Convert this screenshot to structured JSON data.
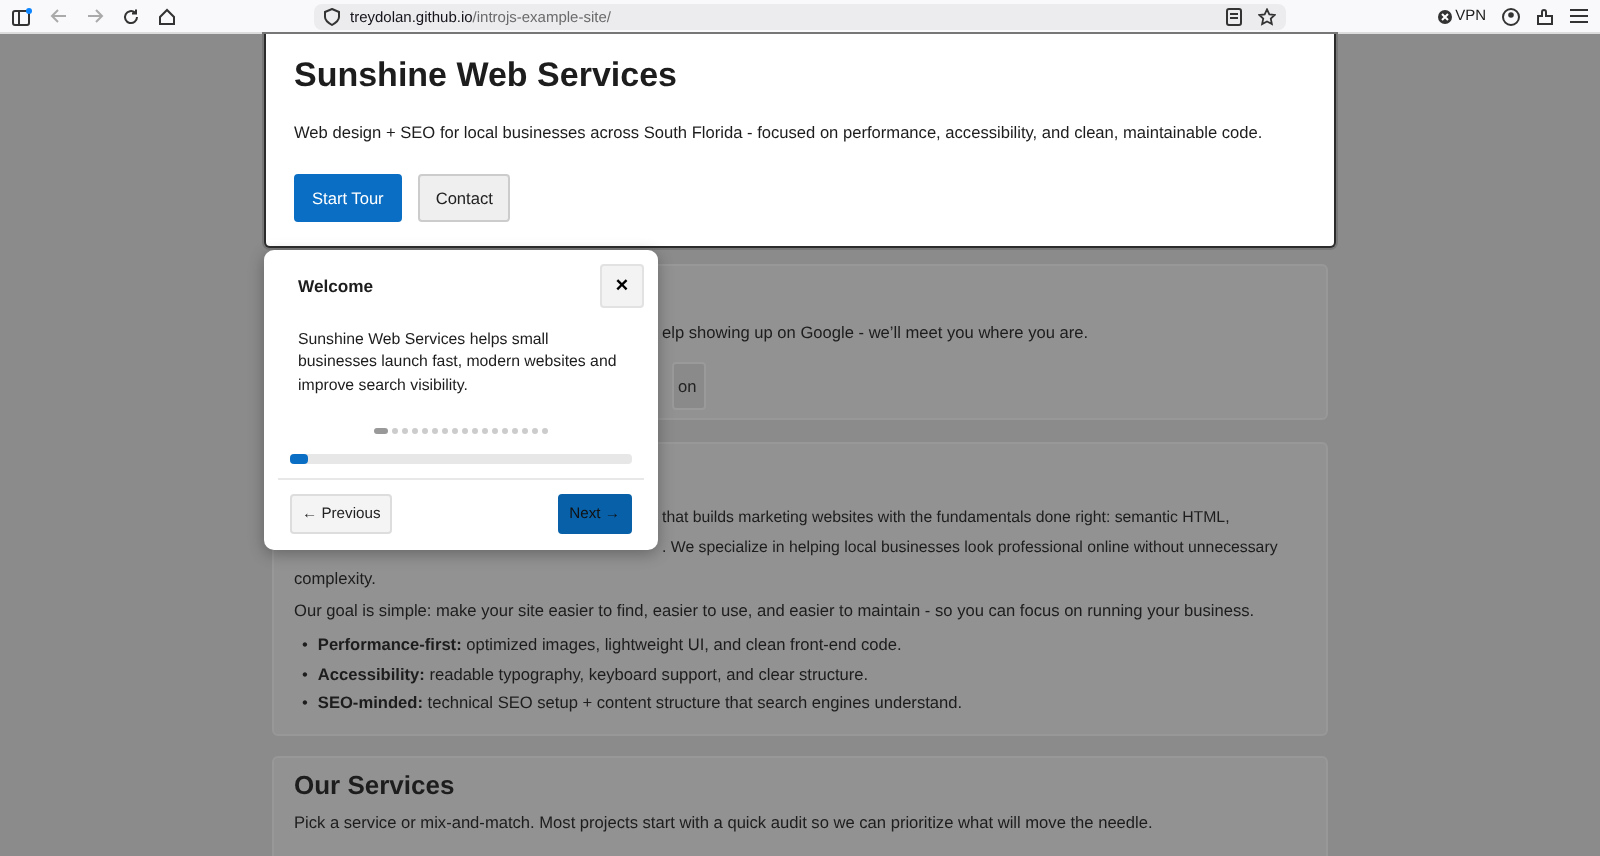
{
  "browser": {
    "url_host": "treydolan.github.io",
    "url_path": "/introjs-example-site/",
    "vpn_label": "VPN"
  },
  "hero": {
    "title": "Sunshine Web Services",
    "subtitle": "Web design + SEO for local businesses across South Florida - focused on performance, accessibility, and clean, maintainable code.",
    "buttons": [
      {
        "label": "Start Tour",
        "kind": "primary"
      },
      {
        "label": "Contact",
        "kind": "secondary"
      }
    ]
  },
  "section_2": {
    "text": "elp showing up on Google - we’ll meet you where you are.",
    "button": "on"
  },
  "section_3": {
    "lines": [
      "that builds marketing websites with the fundamentals done right: semantic HTML,",
      ". We specialize in helping local businesses look professional online without unnecessary"
    ],
    "continuation": "complexity.",
    "paragraph": "Our goal is simple: make your site easier to find, easier to use, and easier to maintain - so you can focus on running your business.",
    "bullet_marker": "•",
    "bullets": [
      "**Performance-first:** optimized images, lightweight UI, and clean front-end code.",
      "**Accessibility:** readable typography, keyboard support, and clear structure.",
      "**SEO-minded:** technical SEO setup + content structure that search engines understand."
    ]
  },
  "services": {
    "title": "Our Services",
    "text": "Pick a service or mix-and-match. Most projects start with a quick audit so we can prioritize what will move the needle."
  },
  "tour": {
    "title": "Welcome",
    "close": "×",
    "text": "Sunshine Web Services helps small businesses launch fast, modern websites and improve search visibility.",
    "steps": [
      {
        "selected": true
      },
      {
        "selected": false
      },
      {
        "selected": false
      },
      {
        "selected": false
      },
      {
        "selected": false
      },
      {
        "selected": false
      },
      {
        "selected": false
      },
      {
        "selected": false
      },
      {
        "selected": false
      },
      {
        "selected": false
      },
      {
        "selected": false
      },
      {
        "selected": false
      },
      {
        "selected": false
      },
      {
        "selected": false
      },
      {
        "selected": false
      },
      {
        "selected": false
      },
      {
        "selected": false
      }
    ],
    "level": 0.05,
    "previous": "← Previous",
    "next": "Next →"
  }
}
